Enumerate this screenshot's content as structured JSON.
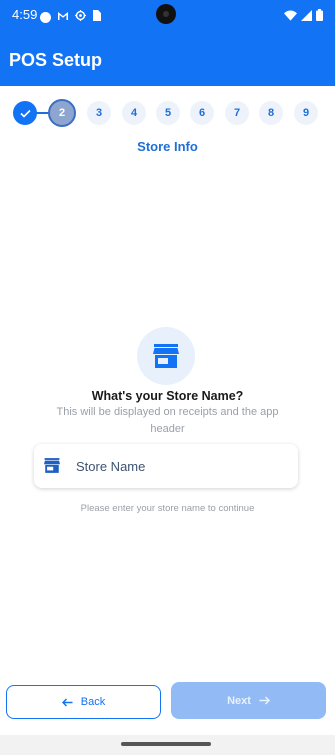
{
  "status_bar": {
    "time": "4:59",
    "left_icons": [
      "record-dot-icon",
      "gmail-icon",
      "settings-icon",
      "sim-icon"
    ],
    "right_icons": [
      "wifi-icon",
      "signal-icon",
      "battery-icon"
    ]
  },
  "app_bar": {
    "title": "POS Setup"
  },
  "stepper": {
    "steps": [
      "✓",
      "2",
      "3",
      "4",
      "5",
      "6",
      "7",
      "8",
      "9"
    ],
    "current_step": 2,
    "current_title": "Store Info"
  },
  "content": {
    "icon": "store-icon",
    "question": "What's your Store Name?",
    "subtitle": "This will be displayed on receipts and the app header",
    "input": {
      "placeholder": "Store Name",
      "value": "",
      "icon": "store-icon"
    },
    "hint": "Please enter your store name to continue"
  },
  "buttons": {
    "back_label": "Back",
    "next_label": "Next",
    "next_enabled": false
  },
  "colors": {
    "primary": "#1273f5",
    "next_disabled": "#92bbf5",
    "icon_bg": "#e7f0fb"
  }
}
